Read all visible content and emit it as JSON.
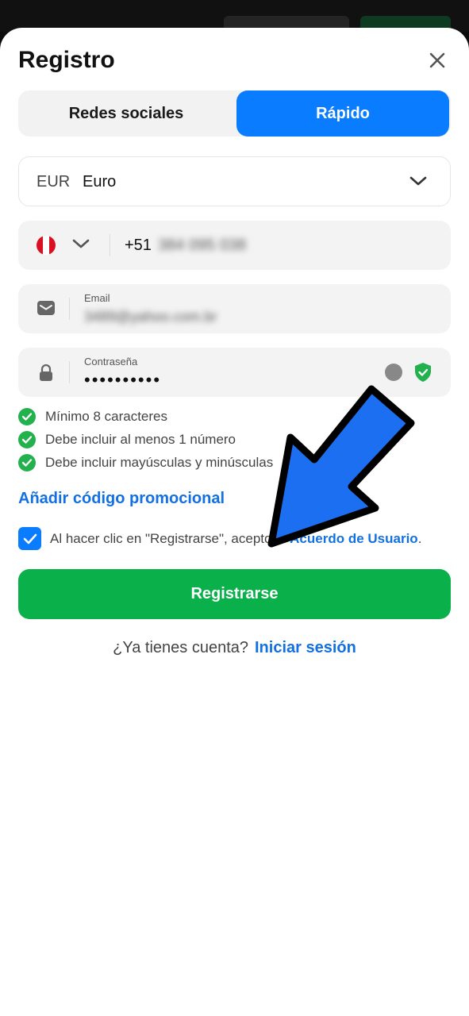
{
  "header": {
    "title": "Registro"
  },
  "tabs": [
    {
      "label": "Redes sociales",
      "active": false
    },
    {
      "label": "Rápido",
      "active": true
    }
  ],
  "currency": {
    "code": "EUR",
    "name": "Euro"
  },
  "phone": {
    "prefix": "+51",
    "number": "384 095 038"
  },
  "email": {
    "label": "Email",
    "value": "3489@yahoo.com.br"
  },
  "password": {
    "label": "Contraseña",
    "value": "••••••••••"
  },
  "password_rules": [
    "Mínimo 8 caracteres",
    "Debe incluir al menos 1 número",
    "Debe incluir mayúsculas y minúsculas"
  ],
  "promo": {
    "label": "Añadir código promocional"
  },
  "agreement": {
    "checked": true,
    "text": "Al hacer clic en \"Registrarse\", acepto el ",
    "link": "Acuerdo de Usuario",
    "suffix": "."
  },
  "submit": {
    "label": "Registrarse"
  },
  "login": {
    "question": "¿Ya tienes cuenta?",
    "link": "Iniciar sesión"
  },
  "colors": {
    "accent_blue": "#0a7cff",
    "link_blue": "#1270e3",
    "success_green": "#0ab14b",
    "arrow": "#1d6ff2"
  },
  "icons": {
    "close": "close-icon",
    "chevron": "chevron-down-icon",
    "email": "envelope-icon",
    "password": "lock-icon",
    "check": "check-icon",
    "shield": "shield-check-icon",
    "flag": "peru-flag-icon",
    "annotation": "arrow-pointer-icon"
  }
}
